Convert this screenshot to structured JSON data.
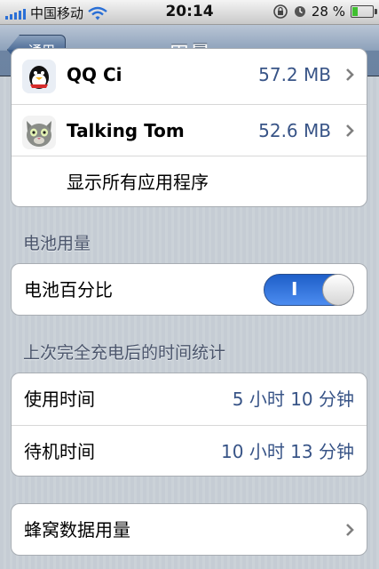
{
  "status_bar": {
    "carrier": "中国移动",
    "time": "20:14",
    "battery_percent_label": "28 %",
    "battery_level": 0.28,
    "icons": [
      "signal-icon",
      "wifi-icon",
      "rotation-lock-icon",
      "alarm-icon",
      "battery-icon"
    ]
  },
  "nav": {
    "back_label": "通用",
    "title": "用量"
  },
  "apps": [
    {
      "name": "QQ Ci",
      "size": "57.2 MB",
      "icon": "qq-app-icon"
    },
    {
      "name": "Talking Tom",
      "size": "52.6 MB",
      "icon": "talking-tom-app-icon"
    }
  ],
  "show_all_label": "显示所有应用程序",
  "battery_section": {
    "header": "电池用量",
    "percent_label": "电池百分比",
    "toggle_on_text": "I",
    "toggle_state": true
  },
  "charge_section": {
    "header": "上次完全充电后的时间统计",
    "usage_label": "使用时间",
    "usage_value": "5 小时 10 分钟",
    "standby_label": "待机时间",
    "standby_value": "10 小时 13 分钟"
  },
  "cellular_label": "蜂窝数据用量",
  "colors": {
    "accent": "#385487",
    "toggle_on": "#2c6fd9",
    "nav_bar": "#6d84a2"
  }
}
